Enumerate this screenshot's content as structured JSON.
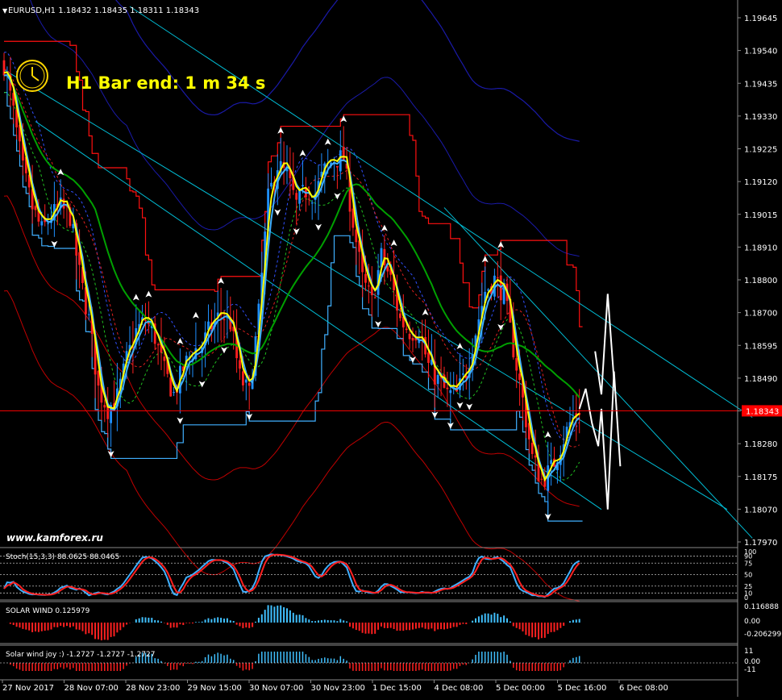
{
  "window": {
    "symbol_title": "EURUSD,H1  1.18432 1.18435 1.18311 1.18343",
    "bar_timer": "H1 Bar end: 1 m 34 s",
    "watermark": "www.kamforex.ru"
  },
  "colors": {
    "background": "#000000",
    "candle_up": "#1e90ff",
    "candle_down": "#ff2020",
    "price_line": "#ff0000",
    "price_tag_bg": "#ff0000",
    "yellow": "#ffff00",
    "cyan": "#00bcd4",
    "green": "#00a000",
    "envelope_outer": "#1a1aa8",
    "envelope_red": "#c00000",
    "channel_red": "#ff1010",
    "channel_cyan": "#40b0ff",
    "white": "#ffffff"
  },
  "chart_data": [
    {
      "type": "candlestick",
      "panel": "main",
      "symbol": "EURUSD",
      "timeframe": "H1",
      "ohlc_last": {
        "open": 1.18432,
        "high": 1.18435,
        "low": 1.18311,
        "close": 1.18343
      },
      "current_price_label": "1.18343",
      "ylim": [
        1.1787,
        1.1975
      ],
      "y_ticks": [
        "1.19645",
        "1.19540",
        "1.19435",
        "1.19330",
        "1.19225",
        "1.19120",
        "1.19015",
        "1.18910",
        "1.18800",
        "1.18700",
        "1.18595",
        "1.18490",
        "1.18385",
        "1.18280",
        "1.18175",
        "1.18070",
        "1.17970"
      ],
      "x_ticks": [
        "27 Nov 2017",
        "28 Nov 07:00",
        "28 Nov 23:00",
        "29 Nov 15:00",
        "30 Nov 07:00",
        "30 Nov 23:00",
        "1 Dec 15:00",
        "4 Dec 08:00",
        "5 Dec 00:00",
        "5 Dec 16:00",
        "6 Dec 08:00"
      ],
      "price_path": [
        [
          0,
          1.1955
        ],
        [
          3,
          1.1938
        ],
        [
          6,
          1.1918
        ],
        [
          9,
          1.1905
        ],
        [
          12,
          1.1897
        ],
        [
          15,
          1.1902
        ],
        [
          18,
          1.1905
        ],
        [
          21,
          1.1902
        ],
        [
          24,
          1.1882
        ],
        [
          27,
          1.1866
        ],
        [
          30,
          1.1842
        ],
        [
          33,
          1.1835
        ],
        [
          36,
          1.1839
        ],
        [
          39,
          1.1852
        ],
        [
          42,
          1.1862
        ],
        [
          45,
          1.1866
        ],
        [
          48,
          1.186
        ],
        [
          51,
          1.1848
        ],
        [
          54,
          1.184
        ],
        [
          57,
          1.1849
        ],
        [
          60,
          1.1855
        ],
        [
          63,
          1.1857
        ],
        [
          66,
          1.1864
        ],
        [
          69,
          1.1868
        ],
        [
          72,
          1.1865
        ],
        [
          75,
          1.1846
        ],
        [
          78,
          1.184
        ],
        [
          81,
          1.1868
        ],
        [
          84,
          1.1908
        ],
        [
          87,
          1.192
        ],
        [
          90,
          1.1916
        ],
        [
          93,
          1.1906
        ],
        [
          96,
          1.1911
        ],
        [
          99,
          1.191
        ],
        [
          102,
          1.1918
        ],
        [
          105,
          1.1922
        ],
        [
          108,
          1.1922
        ],
        [
          111,
          1.19
        ],
        [
          114,
          1.188
        ],
        [
          117,
          1.1872
        ],
        [
          120,
          1.1888
        ],
        [
          123,
          1.188
        ],
        [
          126,
          1.1866
        ],
        [
          129,
          1.1862
        ],
        [
          132,
          1.1862
        ],
        [
          135,
          1.185
        ],
        [
          138,
          1.1845
        ],
        [
          141,
          1.184
        ],
        [
          144,
          1.184
        ],
        [
          147,
          1.1848
        ],
        [
          150,
          1.1862
        ],
        [
          153,
          1.1876
        ],
        [
          156,
          1.188
        ],
        [
          159,
          1.1875
        ],
        [
          162,
          1.1856
        ],
        [
          165,
          1.1838
        ],
        [
          168,
          1.1818
        ],
        [
          171,
          1.181
        ],
        [
          174,
          1.1814
        ],
        [
          177,
          1.1822
        ],
        [
          180,
          1.183
        ],
        [
          183,
          1.1835
        ]
      ],
      "series": [
        {
          "values": [],
          "role": "fast-ma",
          "color": "#ffff00"
        },
        {
          "values": [],
          "role": "signal-ma",
          "color": "#40b0ff"
        },
        {
          "values": [],
          "role": "slow-ma",
          "color": "#00a000"
        }
      ],
      "forecast_path": [
        [
          183,
          1.1835
        ],
        [
          185,
          1.1842
        ],
        [
          187,
          1.183
        ],
        [
          189,
          1.1822
        ],
        [
          190,
          1.1835
        ],
        [
          192,
          1.18
        ],
        [
          194,
          1.1848
        ],
        [
          196,
          1.1815
        ]
      ],
      "forecast_path_2": [
        [
          188,
          1.1855
        ],
        [
          190,
          1.184
        ],
        [
          192,
          1.1875
        ],
        [
          194,
          1.1845
        ]
      ],
      "grid": false,
      "legend": "none"
    },
    {
      "type": "line",
      "panel": "stoch",
      "label": "Stoch(15,3,3) 88.0625 88.0465",
      "ylim": [
        0,
        100
      ],
      "y_ticks": [
        "100",
        "90",
        "75",
        "50",
        "25",
        "10",
        "0"
      ],
      "levels": [
        90,
        75,
        50,
        25,
        10
      ],
      "series": [
        {
          "name": "main",
          "color": "#40b0ff",
          "values": []
        },
        {
          "name": "signal",
          "color": "#ff2020",
          "values": []
        }
      ],
      "last_values": [
        88.0625,
        88.0465
      ]
    },
    {
      "type": "bar",
      "panel": "solar_wind",
      "label": "SOLAR WIND 0.125979",
      "ylim": [
        -0.206299,
        0.116888
      ],
      "y_ticks": [
        "0.116888",
        "0.00",
        "-0.206299"
      ],
      "last_value": 0.125979,
      "values": [],
      "positive_color": "#40c0ff",
      "negative_color": "#ff2020"
    },
    {
      "type": "line",
      "panel": "solar_wind_joy",
      "label": "Solar wind joy :) -1.2727 -1.2727 -1.2727",
      "ylim": [
        -11,
        11
      ],
      "y_ticks": [
        "11",
        "0.00",
        "-11"
      ],
      "last_values": [
        -1.2727,
        -1.2727,
        -1.2727
      ],
      "positive_color": "#40c0ff",
      "negative_color": "#ff2020"
    }
  ]
}
